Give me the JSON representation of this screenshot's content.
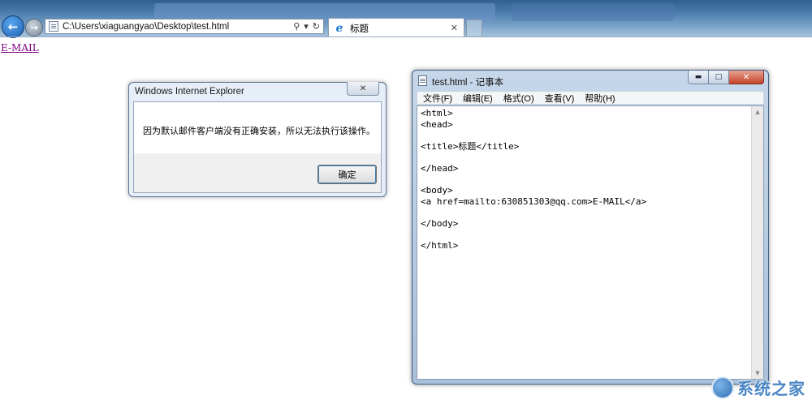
{
  "browser": {
    "address": "C:\\Users\\xiaguangyao\\Desktop\\test.html",
    "tab_title": "标题",
    "icons": {
      "back": "back-arrow-icon",
      "forward": "forward-arrow-icon",
      "search": "search-icon",
      "refresh": "refresh-icon",
      "close_tab": "close-icon"
    }
  },
  "page": {
    "link_text": "E-MAIL"
  },
  "dialog": {
    "title": "Windows Internet Explorer",
    "message": "因为默认邮件客户端没有正确安装，所以无法执行该操作。",
    "ok_label": "确定"
  },
  "notepad": {
    "title": "test.html - 记事本",
    "menus": [
      "文件(F)",
      "编辑(E)",
      "格式(O)",
      "查看(V)",
      "帮助(H)"
    ],
    "content": "<html>\n<head>\n\n<title>标题</title>\n\n</head>\n\n<body>\n<a href=mailto:630851303@qq.com>E-MAIL</a>\n\n</body>\n\n</html>"
  },
  "watermark": {
    "text": "系统之家"
  },
  "colors": {
    "link_visited": "#800080",
    "chrome_blue": "#4d7fae",
    "notepad_frame": "#a9c0da",
    "close_red": "#c7432a"
  }
}
